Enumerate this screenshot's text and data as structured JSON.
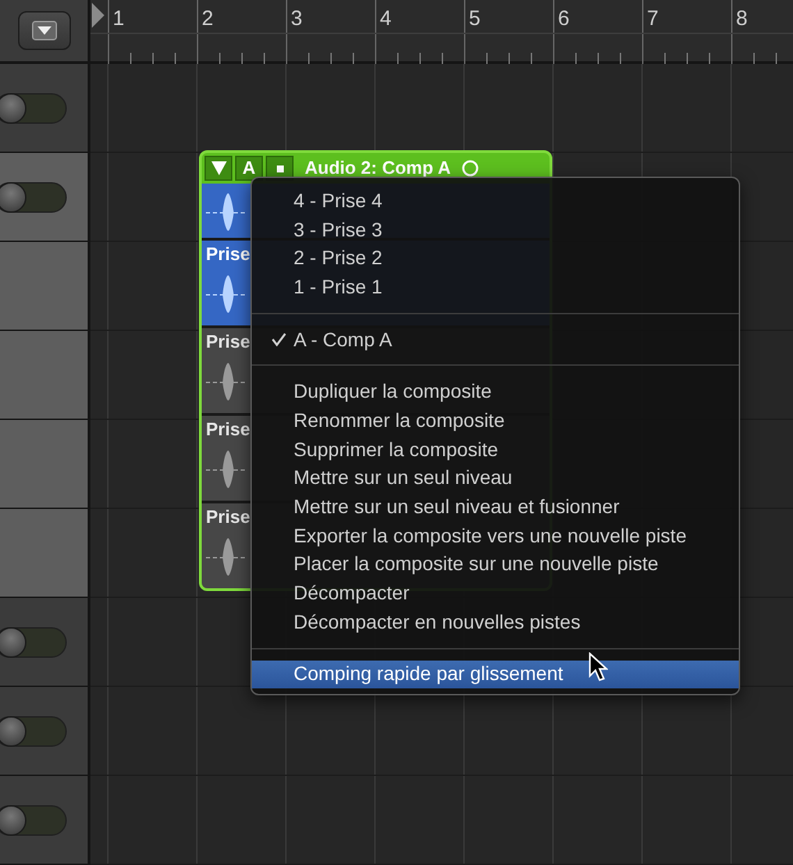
{
  "ruler": {
    "bars": [
      "1",
      "2",
      "3",
      "4",
      "5",
      "6",
      "7",
      "8"
    ]
  },
  "tracks": [
    {
      "selected": false,
      "kind": "switch"
    },
    {
      "selected": true,
      "kind": "switch"
    },
    {
      "selected": true,
      "kind": "plain"
    },
    {
      "selected": true,
      "kind": "plain"
    },
    {
      "selected": true,
      "kind": "plain"
    },
    {
      "selected": true,
      "kind": "plain"
    },
    {
      "selected": false,
      "kind": "switch"
    },
    {
      "selected": false,
      "kind": "switch"
    },
    {
      "selected": false,
      "kind": "switch"
    }
  ],
  "take_folder": {
    "badge": "A",
    "title": "Audio 2: Comp A",
    "lanes": [
      {
        "kind": "comp",
        "selected": true
      },
      {
        "kind": "take",
        "label": "Prise",
        "selected": true
      },
      {
        "kind": "take",
        "label": "Prise",
        "selected": false
      },
      {
        "kind": "take",
        "label": "Prise",
        "selected": false
      },
      {
        "kind": "take",
        "label": "Prise",
        "selected": false
      }
    ]
  },
  "menu": {
    "items": [
      {
        "kind": "item",
        "label": "4 - Prise 4",
        "checked": false,
        "selected": false
      },
      {
        "kind": "item",
        "label": "3 - Prise 3",
        "checked": false,
        "selected": false
      },
      {
        "kind": "item",
        "label": "2 - Prise 2",
        "checked": false,
        "selected": false
      },
      {
        "kind": "item",
        "label": "1 - Prise 1",
        "checked": false,
        "selected": false
      },
      {
        "kind": "separator"
      },
      {
        "kind": "item",
        "label": "A - Comp A",
        "checked": true,
        "selected": false
      },
      {
        "kind": "separator"
      },
      {
        "kind": "item",
        "label": "Dupliquer la composite",
        "checked": false,
        "selected": false
      },
      {
        "kind": "item",
        "label": "Renommer la composite",
        "checked": false,
        "selected": false
      },
      {
        "kind": "item",
        "label": "Supprimer la composite",
        "checked": false,
        "selected": false
      },
      {
        "kind": "item",
        "label": "Mettre sur un seul niveau",
        "checked": false,
        "selected": false
      },
      {
        "kind": "item",
        "label": "Mettre sur un seul niveau et fusionner",
        "checked": false,
        "selected": false
      },
      {
        "kind": "item",
        "label": "Exporter la composite vers une nouvelle piste",
        "checked": false,
        "selected": false
      },
      {
        "kind": "item",
        "label": "Placer la composite sur une nouvelle piste",
        "checked": false,
        "selected": false
      },
      {
        "kind": "item",
        "label": "Décompacter",
        "checked": false,
        "selected": false
      },
      {
        "kind": "item",
        "label": "Décompacter en nouvelles pistes",
        "checked": false,
        "selected": false
      },
      {
        "kind": "separator"
      },
      {
        "kind": "item",
        "label": "Comping rapide par glissement",
        "checked": false,
        "selected": true
      }
    ]
  }
}
